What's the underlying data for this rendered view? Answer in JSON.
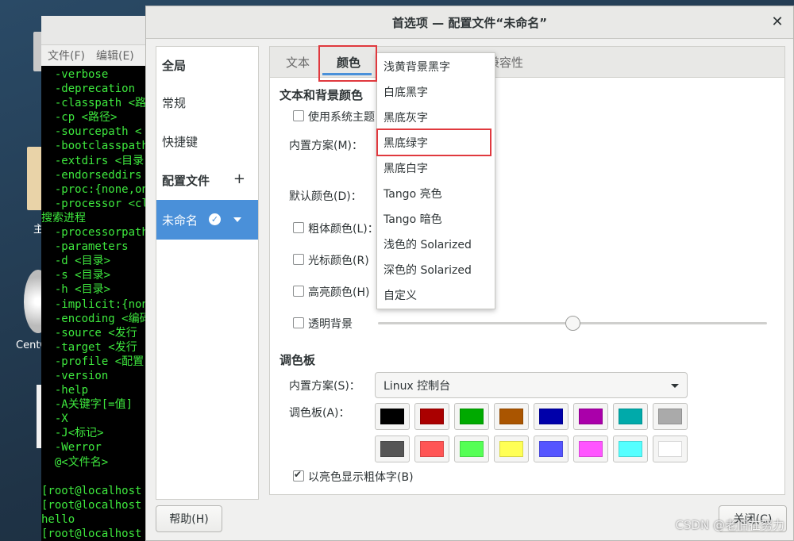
{
  "desktop": {
    "folder_label": "主",
    "disc_label": "CentO"
  },
  "terminal": {
    "menu": [
      "文件(F)",
      "编辑(E)"
    ],
    "lines": [
      "  -verbose",
      "  -deprecation",
      "  -classpath <路",
      "  -cp <路径>",
      "  -sourcepath <",
      "  -bootclasspath",
      "  -extdirs <目录",
      "  -endorseddirs",
      "  -proc:{none,on",
      "  -processor <cl",
      "搜索进程",
      "  -processorpath",
      "  -parameters",
      "  -d <目录>",
      "  -s <目录>",
      "  -h <目录>",
      "  -implicit:{non",
      "  -encoding <编码",
      "  -source <发行",
      "  -target <发行",
      "  -profile <配置",
      "  -version",
      "  -help",
      "  -A关键字[=值]",
      "  -X",
      "  -J<标记>",
      "  -Werror",
      "  @<文件名>",
      "",
      "[root@localhost",
      "[root@localhost",
      "hello",
      "[root@localhost"
    ]
  },
  "dialog": {
    "title": "首选项 — 配置文件“未命名”",
    "close_glyph": "✕",
    "sidebar": {
      "global": "全局",
      "general": "常规",
      "shortcuts": "快捷键",
      "profiles": "配置文件",
      "add_glyph": "+",
      "profile_name": "未命名",
      "check_glyph": "✓"
    },
    "tabs": [
      "文本",
      "颜色",
      "兼容性"
    ],
    "colors": {
      "section_text_bg": "文本和背景颜色",
      "use_system_theme": "使用系统主题",
      "builtin_scheme": "内置方案(M)：",
      "default_color": "默认颜色(D)：",
      "bold_color": "粗体颜色(L)：",
      "cursor_color": "光标颜色(R)",
      "highlight_color": "高亮颜色(H)",
      "transparent_bg": "透明背景",
      "transparency_level": 0.5,
      "section_palette": "调色板",
      "palette_scheme_label": "内置方案(S)：",
      "palette_scheme_value": "Linux 控制台",
      "palette_label": "调色板(A)：",
      "palette_row1": [
        "#000000",
        "#aa0000",
        "#00aa00",
        "#aa5500",
        "#0000aa",
        "#aa00aa",
        "#00aaaa",
        "#aaaaaa"
      ],
      "palette_row2": [
        "#555555",
        "#ff5555",
        "#55ff55",
        "#ffff55",
        "#5555ff",
        "#ff55ff",
        "#55ffff",
        "#ffffff"
      ],
      "bold_bright": "以亮色显示粗体字(B)"
    },
    "scheme_menu": [
      "浅黄背景黑字",
      "白底黑字",
      "黑底灰字",
      "黑底绿字",
      "黑底白字",
      "Tango 亮色",
      "Tango 暗色",
      "浅色的 Solarized",
      "深色的 Solarized",
      "自定义"
    ],
    "help_button": "帮助(H)",
    "close_button": "关闭(C)"
  },
  "watermark": "CSDN @老旧在努力",
  "accent_color": "#4a90d9",
  "highlight_box_color": "#e0393e"
}
